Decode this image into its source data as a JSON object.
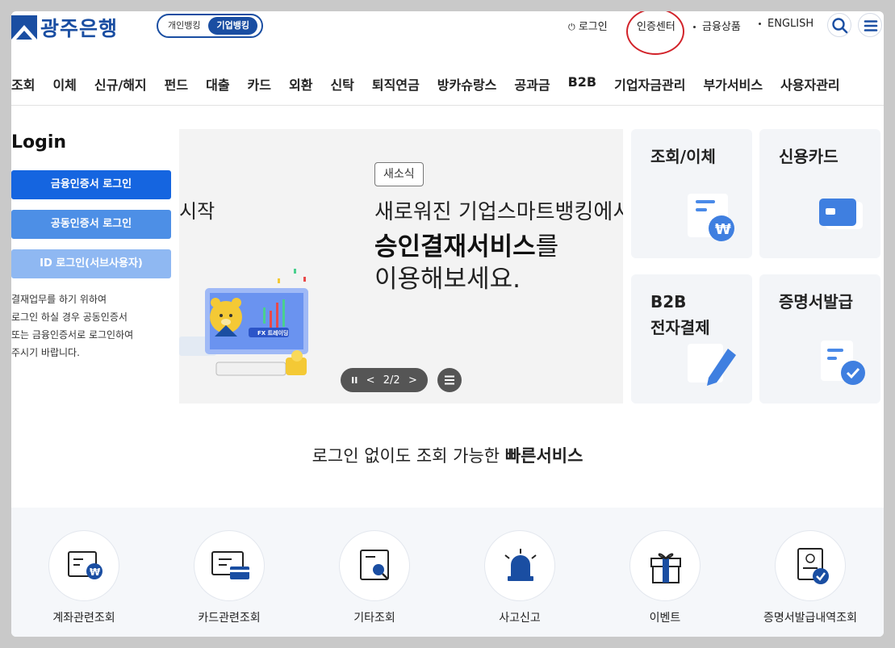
{
  "header": {
    "bank_name": "광주은행",
    "toggle_personal": "개인뱅킹",
    "toggle_business": "기업뱅킹",
    "login_link": "로그인",
    "cert_center": "인증센터",
    "products": "금융상품",
    "english": "ENGLISH"
  },
  "nav": [
    "조회",
    "이체",
    "신규/해지",
    "펀드",
    "대출",
    "카드",
    "외환",
    "신탁",
    "퇴직연금",
    "방카슈랑스",
    "공과금",
    "B2B",
    "기업자금관리",
    "부가서비스",
    "사용자관리"
  ],
  "login": {
    "title": "Login",
    "btn_financial": "금융인증서 로그인",
    "btn_joint": "공동인증서 로그인",
    "btn_id": "ID 로그인(서브사용자)",
    "desc_lines": [
      "결재업무를 하기 위하여",
      "로그인 하실 경우 공동인증서",
      "또는 금융인증서로 로그인하여",
      "주시기 바랍니다."
    ]
  },
  "banner": {
    "prev_text": "시작",
    "tag": "새소식",
    "line1": "새로워진 기업스마트뱅킹에서",
    "line2_bold": "승인결재서비스",
    "line2_rest": "를",
    "line3": "이용해보세요.",
    "fx_label": "FX 트레이딩",
    "pager_text": "2/2",
    "pause": "II",
    "prev": "<",
    "next": ">"
  },
  "cards": [
    {
      "title": "조회/이체",
      "icon": "won-document-icon"
    },
    {
      "title": "신용카드",
      "icon": "credit-card-icon"
    },
    {
      "title": "B2B\n전자결제",
      "icon": "pencil-document-icon"
    },
    {
      "title": "증명서발급",
      "icon": "check-document-icon"
    }
  ],
  "fast": {
    "title_normal": "로그인 없이도 조회 가능한 ",
    "title_bold": "빠른서비스",
    "items": [
      {
        "label": "계좌관련조회",
        "icon": "account-won-icon"
      },
      {
        "label": "카드관련조회",
        "icon": "card-monitor-icon"
      },
      {
        "label": "기타조회",
        "icon": "magnifier-document-icon"
      },
      {
        "label": "사고신고",
        "icon": "siren-icon"
      },
      {
        "label": "이벤트",
        "icon": "gift-icon"
      },
      {
        "label": "증명서발급내역조회",
        "icon": "certificate-check-icon"
      }
    ]
  },
  "colors": {
    "brand": "#1a4ea2",
    "accent_blue": "#1565e0",
    "highlight_red": "#d2232a"
  }
}
